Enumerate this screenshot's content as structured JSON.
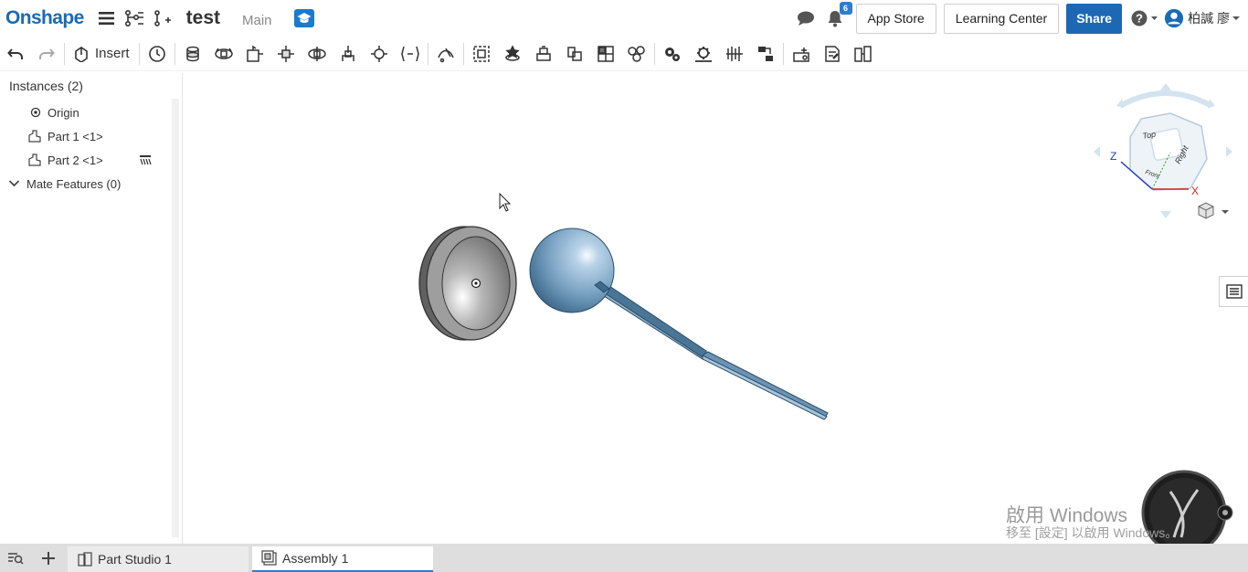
{
  "header": {
    "logo": "Onshape",
    "document_title": "test",
    "workspace": "Main",
    "notification_count": "6",
    "app_store_label": "App Store",
    "learning_center_label": "Learning Center",
    "share_label": "Share",
    "user_name": "柏諴 廖"
  },
  "toolbar": {
    "insert_label": "Insert"
  },
  "instances": {
    "title": "Instances (2)",
    "items": [
      {
        "label": "Origin",
        "icon": "origin-icon"
      },
      {
        "label": "Part 1 <1>",
        "icon": "part-icon"
      },
      {
        "label": "Part 2 <1>",
        "icon": "part-icon"
      }
    ],
    "mate_features": "Mate Features (0)"
  },
  "view_cube": {
    "top": "Top",
    "right": "Right",
    "front": "Front",
    "axis_z": "Z",
    "axis_x": "X"
  },
  "watermark": {
    "line1": "啟用 Windows",
    "line2": "移至 [設定] 以啟用 Windows。"
  },
  "tabs": [
    {
      "label": "Part Studio 1",
      "active": false
    },
    {
      "label": "Assembly 1",
      "active": true
    }
  ],
  "colors": {
    "brand": "#1a6bb3",
    "share": "#1c68b5",
    "part_blue": "#7fa8c9",
    "part_gray": "#8a8a8a"
  }
}
